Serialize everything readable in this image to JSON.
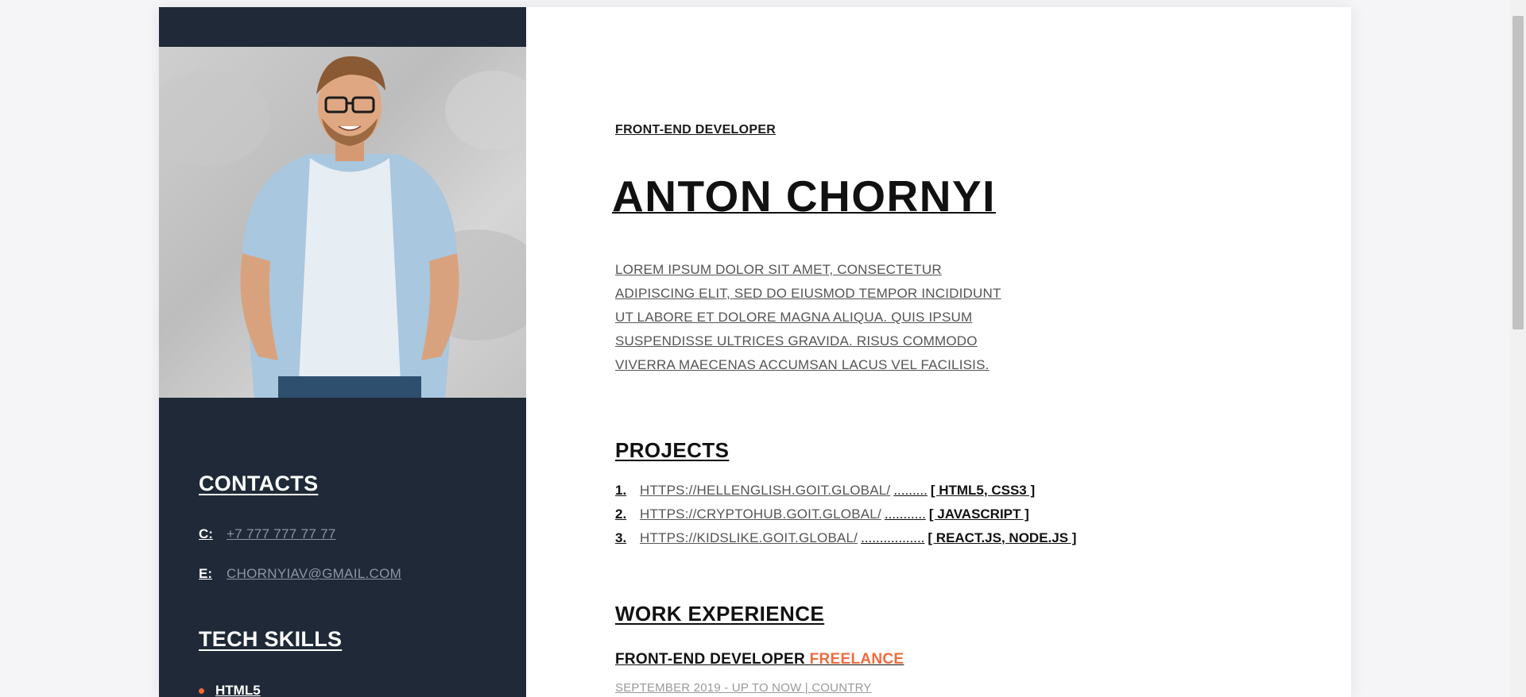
{
  "sidebar": {
    "contacts_heading": "CONTACTS",
    "contacts": [
      {
        "key": "C:",
        "value": "+7 777 777 77 77"
      },
      {
        "key": "E:",
        "value": "CHORNYIAV@GMAIL.COM"
      }
    ],
    "skills_heading": "TECH SKILLS",
    "skills": [
      "HTML5"
    ]
  },
  "main": {
    "role": "FRONT-END DEVELOPER",
    "name": "ANTON CHORNYI",
    "intro": "LOREM IPSUM DOLOR SIT AMET, CONSECTETUR ADIPISCING ELIT, SED DO EIUSMOD TEMPOR INCIDIDUNT UT LABORE ET DOLORE MAGNA ALIQUA. QUIS IPSUM SUSPENDISSE ULTRICES GRAVIDA. RISUS COMMODO VIVERRA MAECENAS ACCUMSAN LACUS VEL FACILISIS.",
    "projects_heading": "PROJECTS",
    "projects": [
      {
        "num": "1.",
        "link": "HTTPS://HELLENGLISH.GOIT.GLOBAL/",
        "dots": ".........",
        "tech": "[ HTML5, CSS3 ]"
      },
      {
        "num": "2.",
        "link": "HTTPS://CRYPTOHUB.GOIT.GLOBAL/",
        "dots": "...........",
        "tech": "[ JAVASCRIPT ]"
      },
      {
        "num": "3.",
        "link": "HTTPS://KIDSLIKE.GOIT.GLOBAL/",
        "dots": ".................",
        "tech": "[ REACT.JS, NODE.JS ]"
      }
    ],
    "experience_heading": "WORK EXPERIENCE",
    "job": {
      "title": "FRONT-END DEVELOPER",
      "type": "FREELANCE",
      "meta": "SEPTEMBER 2019 - UP TO NOW | COUNTRY"
    }
  },
  "colors": {
    "sidebar_bg": "#1f2937",
    "accent": "#f06b3d",
    "link_gray": "#8b95a4"
  }
}
